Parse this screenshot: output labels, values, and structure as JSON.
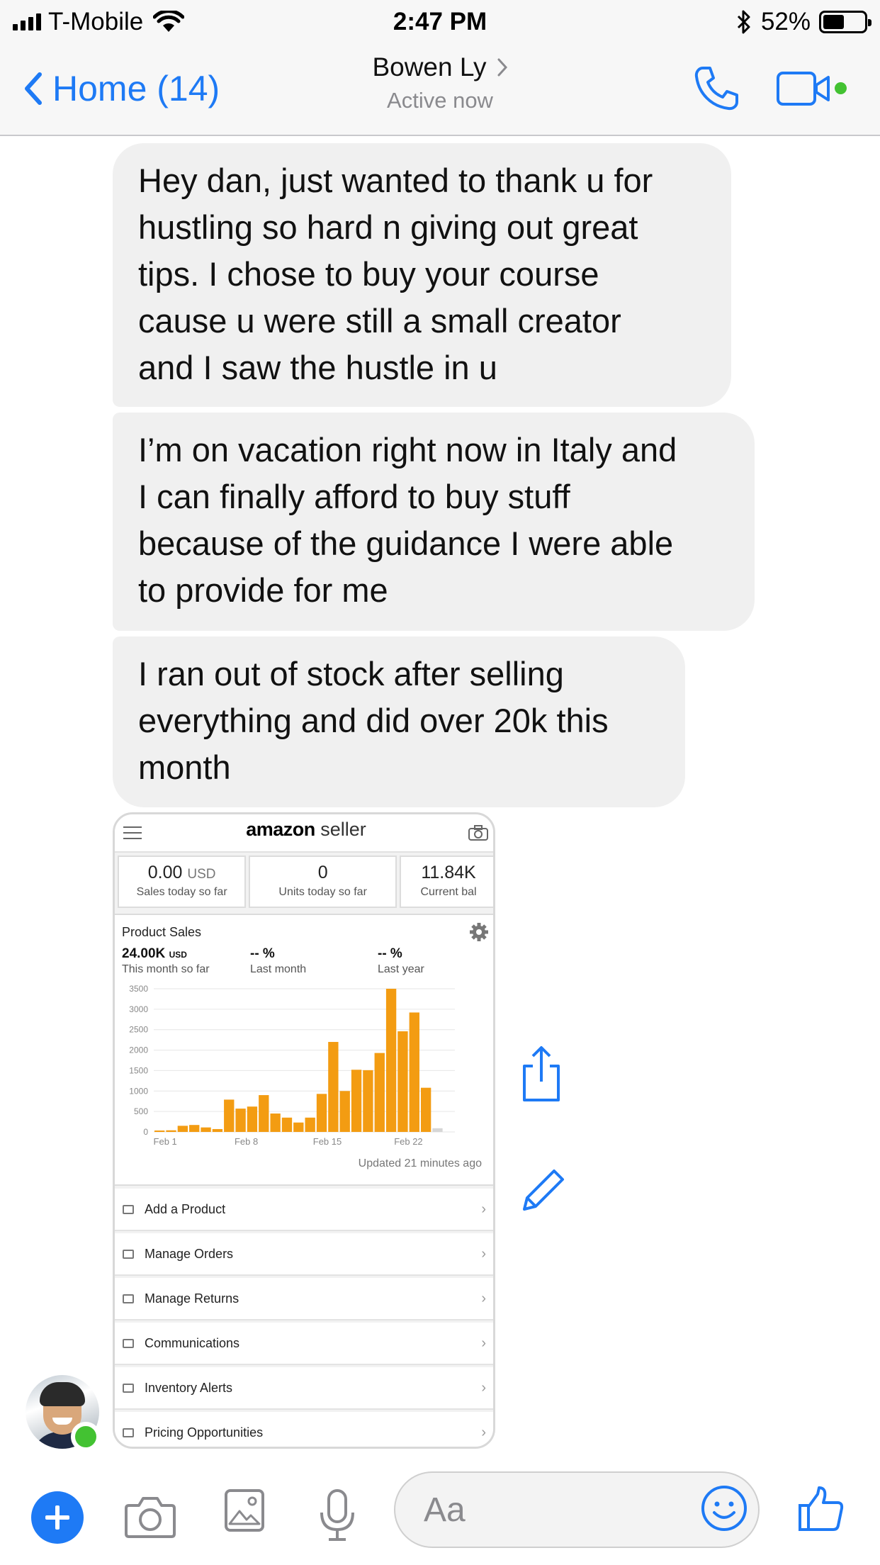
{
  "status_bar": {
    "carrier": "T-Mobile",
    "time": "2:47 PM",
    "battery": "52%",
    "battery_level": 0.52
  },
  "nav": {
    "back_label": "Home (14)",
    "contact_name": "Bowen Ly",
    "contact_status": "Active now",
    "accent_color": "#1e7af5",
    "online_color": "#43c232"
  },
  "messages": [
    {
      "lines": [
        "Hey dan, just wanted to thank u for",
        "hustling so hard n giving out great",
        "tips. I chose to buy your course",
        "cause u were still a small creator",
        "and I saw the hustle in u"
      ]
    },
    {
      "lines": [
        "I’m on vacation right now in Italy and",
        "I can finally afford to buy stuff",
        "because of the guidance I were able",
        "to provide for me"
      ]
    },
    {
      "lines": [
        "I ran out of stock after selling",
        "everything and did over 20k this",
        "month"
      ]
    }
  ],
  "attachment": {
    "brand_bold": "amazon",
    "brand_rest": " seller",
    "stats": [
      {
        "value": "0.00",
        "unit": "USD",
        "label": "Sales today so far"
      },
      {
        "value": "0",
        "unit": "",
        "label": "Units today so far"
      },
      {
        "value": "11.84K",
        "unit": "",
        "label": "Current bal"
      }
    ],
    "card_title": "Product Sales",
    "metrics": [
      {
        "value": "24.00K",
        "unit": "USD",
        "label": "This month so far"
      },
      {
        "value": "-- %",
        "unit": "",
        "label": "Last month"
      },
      {
        "value": "-- %",
        "unit": "",
        "label": "Last year"
      }
    ],
    "updated": "Updated 21 minutes ago",
    "menu": [
      "Add a Product",
      "Manage Orders",
      "Manage Returns",
      "Communications",
      "Inventory Alerts",
      "Pricing Opportunities"
    ]
  },
  "chart_data": {
    "type": "bar",
    "title": "Product Sales",
    "xlabel": "",
    "ylabel": "",
    "ylim": [
      0,
      3500
    ],
    "y_ticks": [
      "3500",
      "3000",
      "2500",
      "2000",
      "1500",
      "1000",
      "500",
      "0"
    ],
    "x_tick_labels": [
      "Feb 1",
      "Feb 8",
      "Feb 15",
      "Feb 22"
    ],
    "grid": true,
    "bar_color": "#f39c12",
    "categories": [
      "Feb 1",
      "Feb 2",
      "Feb 3",
      "Feb 4",
      "Feb 5",
      "Feb 6",
      "Feb 7",
      "Feb 8",
      "Feb 9",
      "Feb 10",
      "Feb 11",
      "Feb 12",
      "Feb 13",
      "Feb 14",
      "Feb 15",
      "Feb 16",
      "Feb 17",
      "Feb 18",
      "Feb 19",
      "Feb 20",
      "Feb 21",
      "Feb 22",
      "Feb 23",
      "Feb 24",
      "Feb 25",
      "Feb 26"
    ],
    "values": [
      20,
      40,
      150,
      170,
      110,
      70,
      790,
      570,
      620,
      900,
      450,
      350,
      230,
      350,
      930,
      2200,
      1000,
      1520,
      1510,
      1930,
      3500,
      2460,
      2920,
      1080,
      90,
      0
    ]
  },
  "composer": {
    "placeholder": "Aa"
  }
}
